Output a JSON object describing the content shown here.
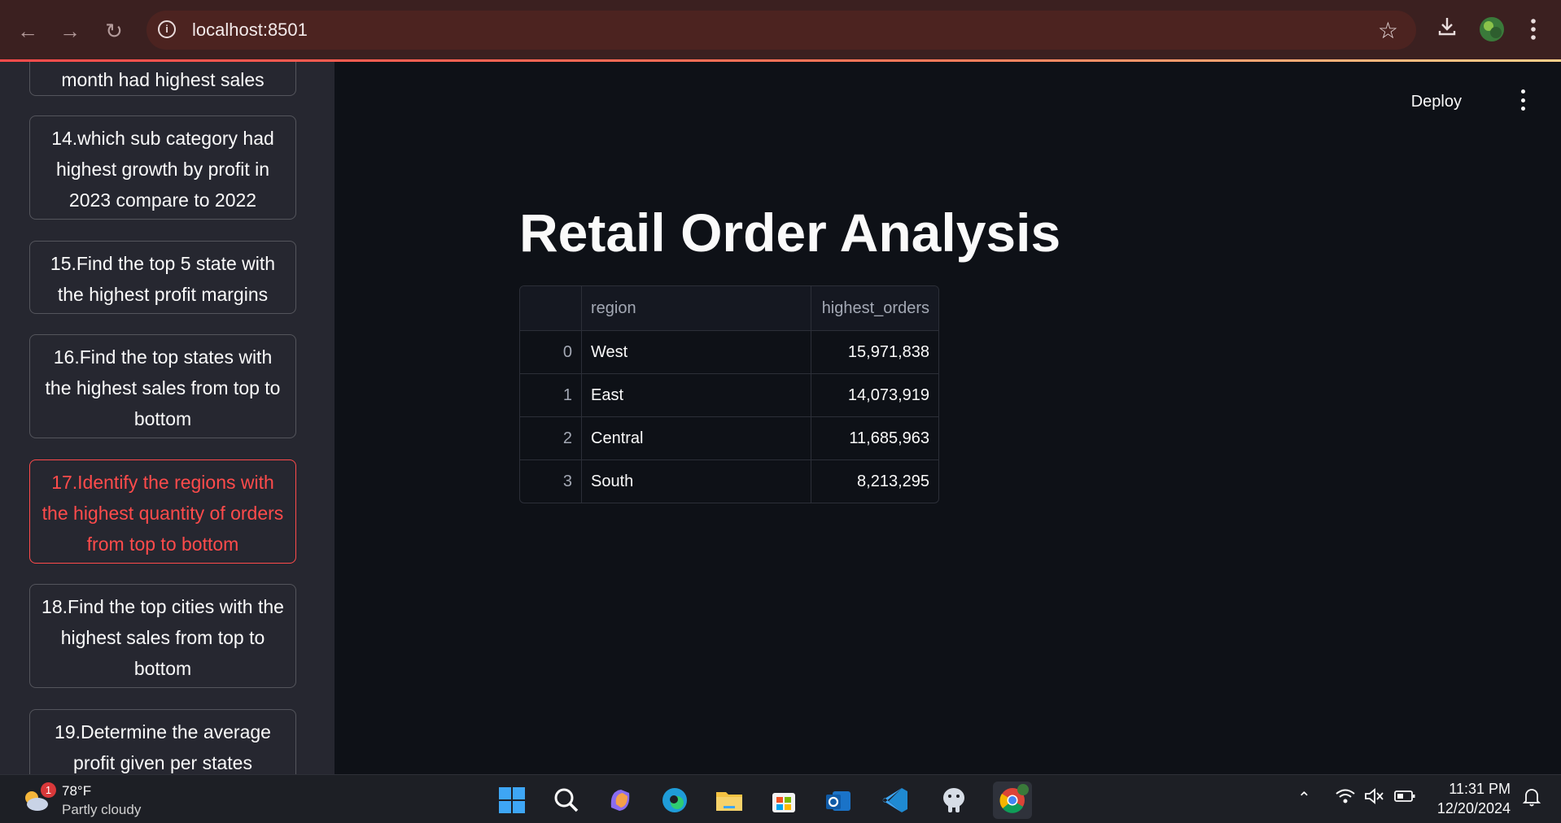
{
  "browser": {
    "url": "localhost:8501"
  },
  "sidebar": {
    "items": [
      {
        "label": "month had highest sales",
        "active": false
      },
      {
        "label": "14.which sub category had highest growth by profit in 2023 compare to 2022",
        "active": false
      },
      {
        "label": "15.Find the top 5 state with the highest profit margins",
        "active": false
      },
      {
        "label": "16.Find the top states with the highest sales from top to bottom",
        "active": false
      },
      {
        "label": "17.Identify the regions with the highest quantity of orders from top to bottom",
        "active": true
      },
      {
        "label": "18.Find the top cities with the highest sales from top to bottom",
        "active": false
      },
      {
        "label": "19.Determine the average profit given per states",
        "active": false
      }
    ]
  },
  "header": {
    "deploy_label": "Deploy"
  },
  "main": {
    "title": "Retail Order Analysis",
    "table": {
      "columns": [
        "",
        "region",
        "highest_orders"
      ],
      "rows": [
        {
          "index": "0",
          "region": "West",
          "highest_orders": "15,971,838"
        },
        {
          "index": "1",
          "region": "East",
          "highest_orders": "14,073,919"
        },
        {
          "index": "2",
          "region": "Central",
          "highest_orders": "11,685,963"
        },
        {
          "index": "3",
          "region": "South",
          "highest_orders": "8,213,295"
        }
      ]
    }
  },
  "taskbar": {
    "weather": {
      "badge": "1",
      "temp": "78°F",
      "condition": "Partly cloudy"
    },
    "clock": {
      "time": "11:31 PM",
      "date": "12/20/2024"
    },
    "apps": [
      "start-icon",
      "search-icon",
      "copilot-icon",
      "edge-icon",
      "file-explorer-icon",
      "store-icon",
      "outlook-icon",
      "vscode-icon",
      "postgres-icon",
      "chrome-icon"
    ]
  },
  "colors": {
    "accent": "#ff4b4b",
    "background": "#0e1117",
    "sidebar": "#262730"
  }
}
